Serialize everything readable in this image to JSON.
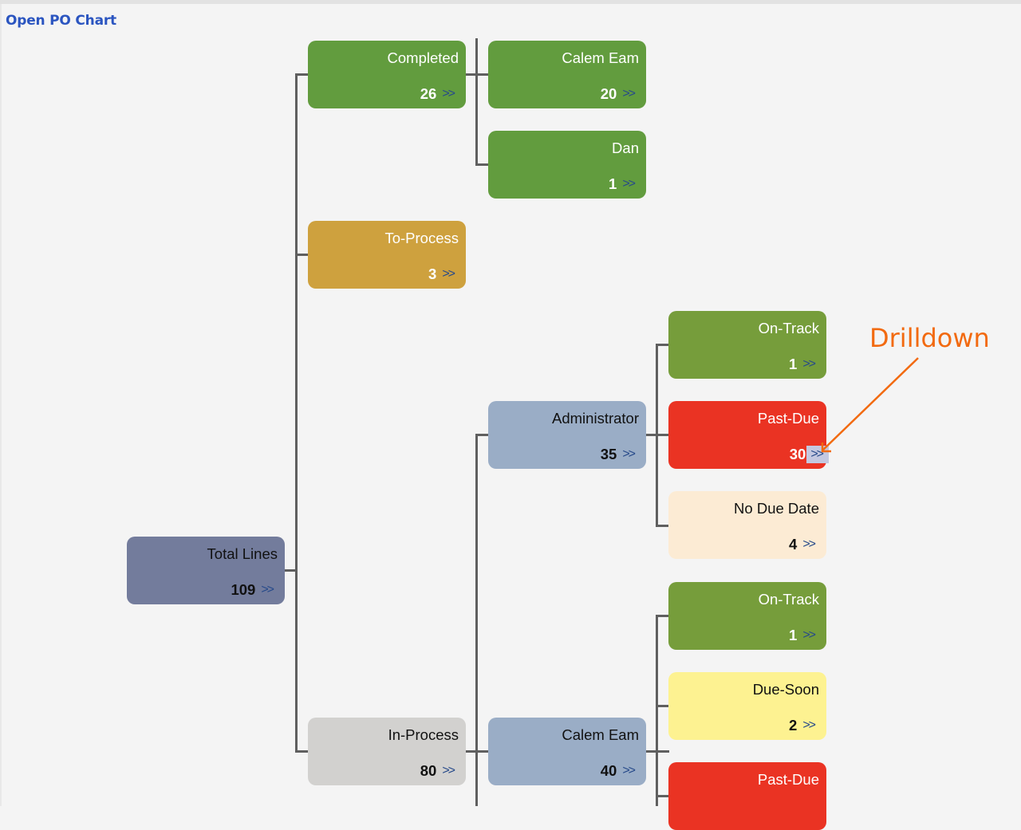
{
  "header": {
    "title": "Open PO Chart"
  },
  "drill_symbol": ">>",
  "annotation": {
    "text": "Drilldown",
    "color": "#f26a10"
  },
  "nodes": {
    "total": {
      "label": "Total Lines",
      "count": "109",
      "color": "#737c9c"
    },
    "completed": {
      "label": "Completed",
      "count": "26",
      "color": "#629c3e"
    },
    "comp_calem": {
      "label": "Calem Eam",
      "count": "20",
      "color": "#629c3e"
    },
    "comp_dan": {
      "label": "Dan",
      "count": "1",
      "color": "#629c3e"
    },
    "toprocess": {
      "label": "To-Process",
      "count": "3",
      "color": "#cea13e"
    },
    "admin": {
      "label": "Administrator",
      "count": "35",
      "color": "#9aadc6"
    },
    "admin_ontrack": {
      "label": "On-Track",
      "count": "1",
      "color": "#769d3b"
    },
    "admin_pastdue": {
      "label": "Past-Due",
      "count": "30",
      "color": "#ea3323"
    },
    "admin_nodue": {
      "label": "No Due Date",
      "count": "4",
      "color": "#fcebd4"
    },
    "inprocess": {
      "label": "In-Process",
      "count": "80",
      "color": "#d2d1cf"
    },
    "ip_calem": {
      "label": "Calem Eam",
      "count": "40",
      "color": "#9aadc6"
    },
    "cal_ontrack": {
      "label": "On-Track",
      "count": "1",
      "color": "#769d3b"
    },
    "cal_duesoon": {
      "label": "Due-Soon",
      "count": "2",
      "color": "#fdf291"
    },
    "cal_pastdue": {
      "label": "Past-Due",
      "count": "",
      "color": "#ea3323"
    }
  }
}
